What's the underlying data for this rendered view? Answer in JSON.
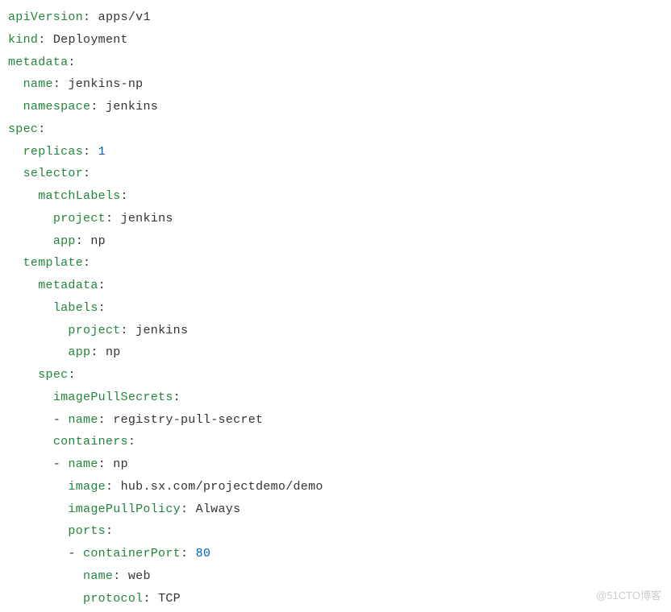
{
  "yaml": {
    "lines": [
      {
        "indent": 0,
        "key": "apiVersion",
        "value": "apps/v1",
        "type": "value"
      },
      {
        "indent": 0,
        "key": "kind",
        "value": "Deployment",
        "type": "value"
      },
      {
        "indent": 0,
        "key": "metadata",
        "value": "",
        "type": "map"
      },
      {
        "indent": 1,
        "key": "name",
        "value": "jenkins-np",
        "type": "value"
      },
      {
        "indent": 1,
        "key": "namespace",
        "value": "jenkins",
        "type": "value"
      },
      {
        "indent": 0,
        "key": "spec",
        "value": "",
        "type": "map"
      },
      {
        "indent": 1,
        "key": "replicas",
        "value": "1",
        "type": "number"
      },
      {
        "indent": 1,
        "key": "selector",
        "value": "",
        "type": "map"
      },
      {
        "indent": 2,
        "key": "matchLabels",
        "value": "",
        "type": "map"
      },
      {
        "indent": 3,
        "key": "project",
        "value": "jenkins",
        "type": "value"
      },
      {
        "indent": 3,
        "key": "app",
        "value": "np",
        "type": "value"
      },
      {
        "indent": 1,
        "key": "template",
        "value": "",
        "type": "map"
      },
      {
        "indent": 2,
        "key": "metadata",
        "value": "",
        "type": "map"
      },
      {
        "indent": 3,
        "key": "labels",
        "value": "",
        "type": "map"
      },
      {
        "indent": 4,
        "key": "project",
        "value": "jenkins",
        "type": "value"
      },
      {
        "indent": 4,
        "key": "app",
        "value": "np",
        "type": "value"
      },
      {
        "indent": 2,
        "key": "spec",
        "value": "",
        "type": "map"
      },
      {
        "indent": 3,
        "key": "imagePullSecrets",
        "value": "",
        "type": "map"
      },
      {
        "indent": 3,
        "key": "name",
        "value": "registry-pull-secret",
        "type": "listvalue"
      },
      {
        "indent": 3,
        "key": "containers",
        "value": "",
        "type": "map"
      },
      {
        "indent": 3,
        "key": "name",
        "value": "np",
        "type": "listvalue"
      },
      {
        "indent": 4,
        "key": "image",
        "value": "hub.sx.com/projectdemo/demo",
        "type": "value"
      },
      {
        "indent": 4,
        "key": "imagePullPolicy",
        "value": "Always",
        "type": "value"
      },
      {
        "indent": 4,
        "key": "ports",
        "value": "",
        "type": "map"
      },
      {
        "indent": 4,
        "key": "containerPort",
        "value": "80",
        "type": "listnumber"
      },
      {
        "indent": 5,
        "key": "name",
        "value": "web",
        "type": "value"
      },
      {
        "indent": 5,
        "key": "protocol",
        "value": "TCP",
        "type": "value"
      }
    ]
  },
  "watermark": "@51CTO博客"
}
